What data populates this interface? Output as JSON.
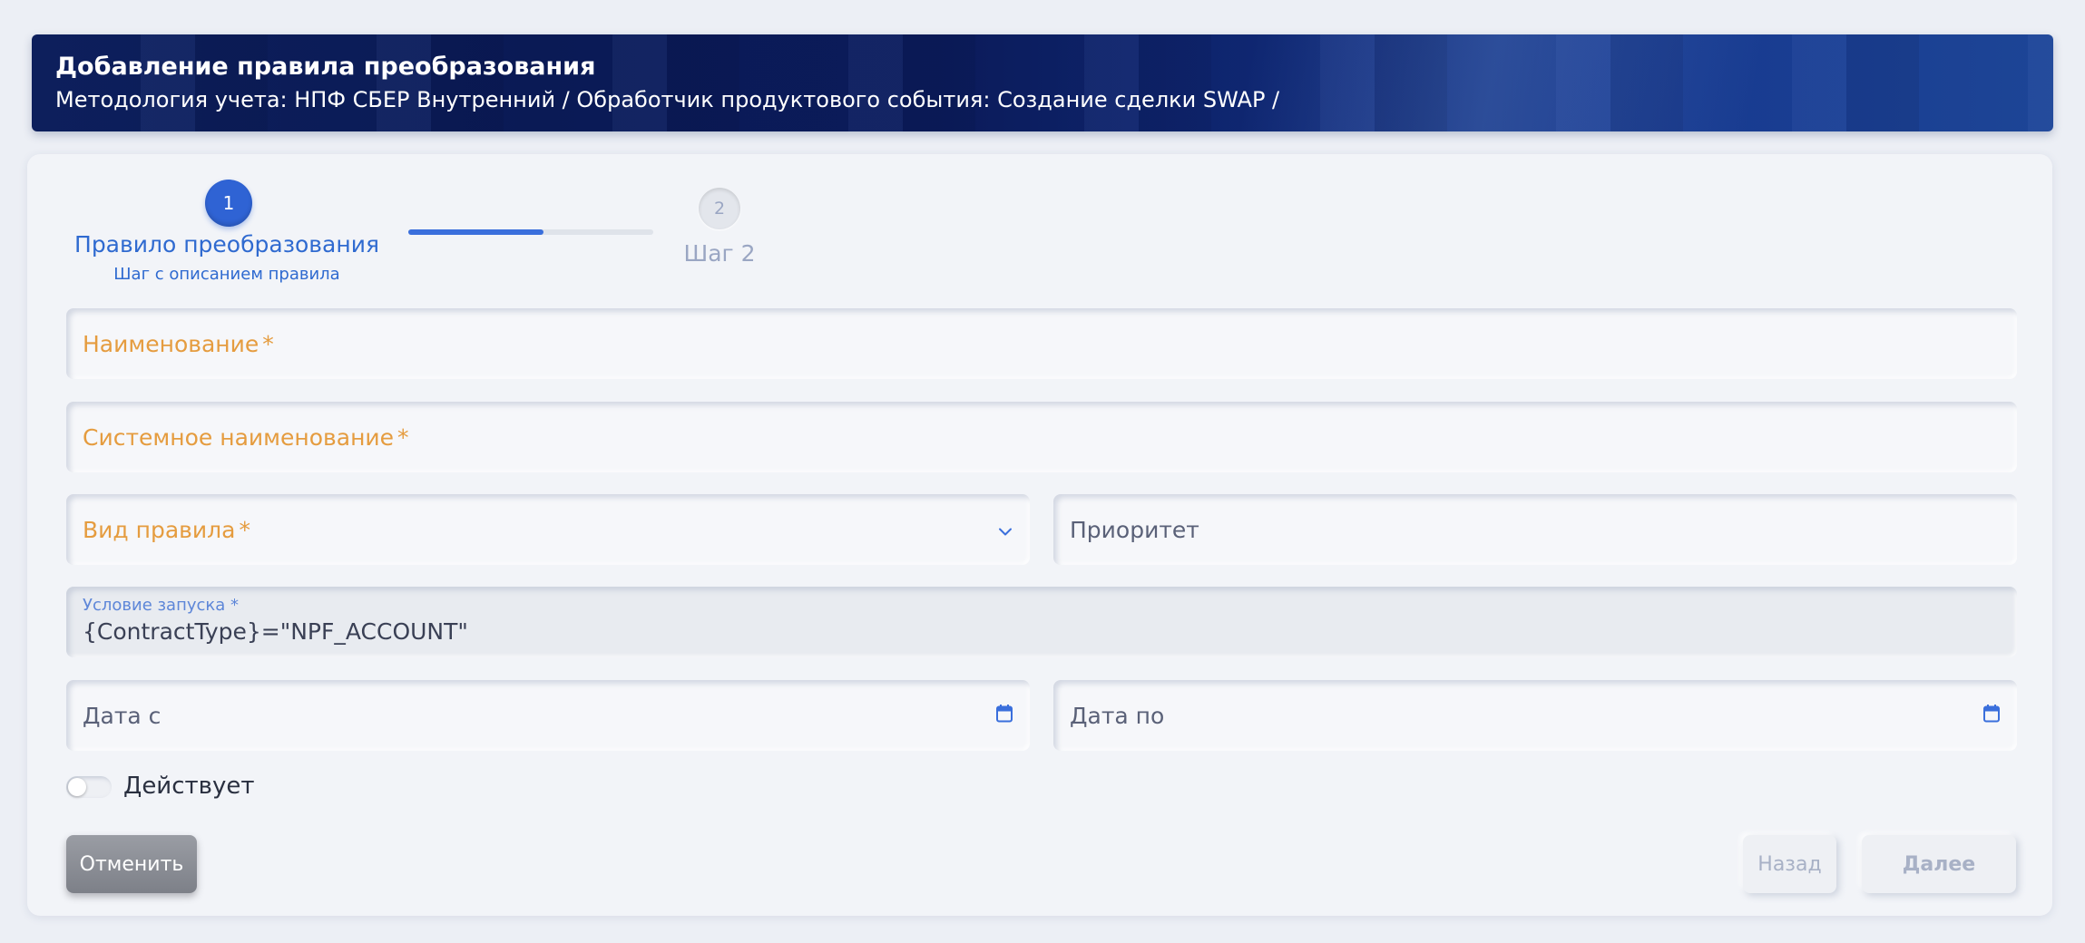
{
  "header": {
    "title": "Добавление правила преобразования",
    "breadcrumb": "Методология учета: НПФ СБЕР Внутренний / Обработчик продуктового события: Создание сделки SWAP /"
  },
  "stepper": {
    "steps": [
      {
        "number": "1",
        "title": "Правило преобразования",
        "description": "Шаг с описанием правила",
        "state": "active"
      },
      {
        "number": "2",
        "title": "Шаг 2",
        "description": "",
        "state": "inactive"
      }
    ],
    "progress_fraction": 0.55
  },
  "form": {
    "name_label": "Наименование",
    "system_name_label": "Системное наименование",
    "rule_type_label": "Вид правила",
    "priority_label": "Приоритет",
    "required_mark": "*",
    "condition": {
      "label": "Условие запуска *",
      "value": "{ContractType}=\"NPF_ACCOUNT\""
    },
    "date_from_label": "Дата с",
    "date_to_label": "Дата по",
    "active_toggle": {
      "label": "Действует",
      "checked": false
    }
  },
  "buttons": {
    "cancel": "Отменить",
    "back": "Назад",
    "next": "Далее"
  },
  "colors": {
    "accent": "#2f63d4",
    "required": "#e59c3f",
    "disabled_text": "#a8b1c6"
  }
}
